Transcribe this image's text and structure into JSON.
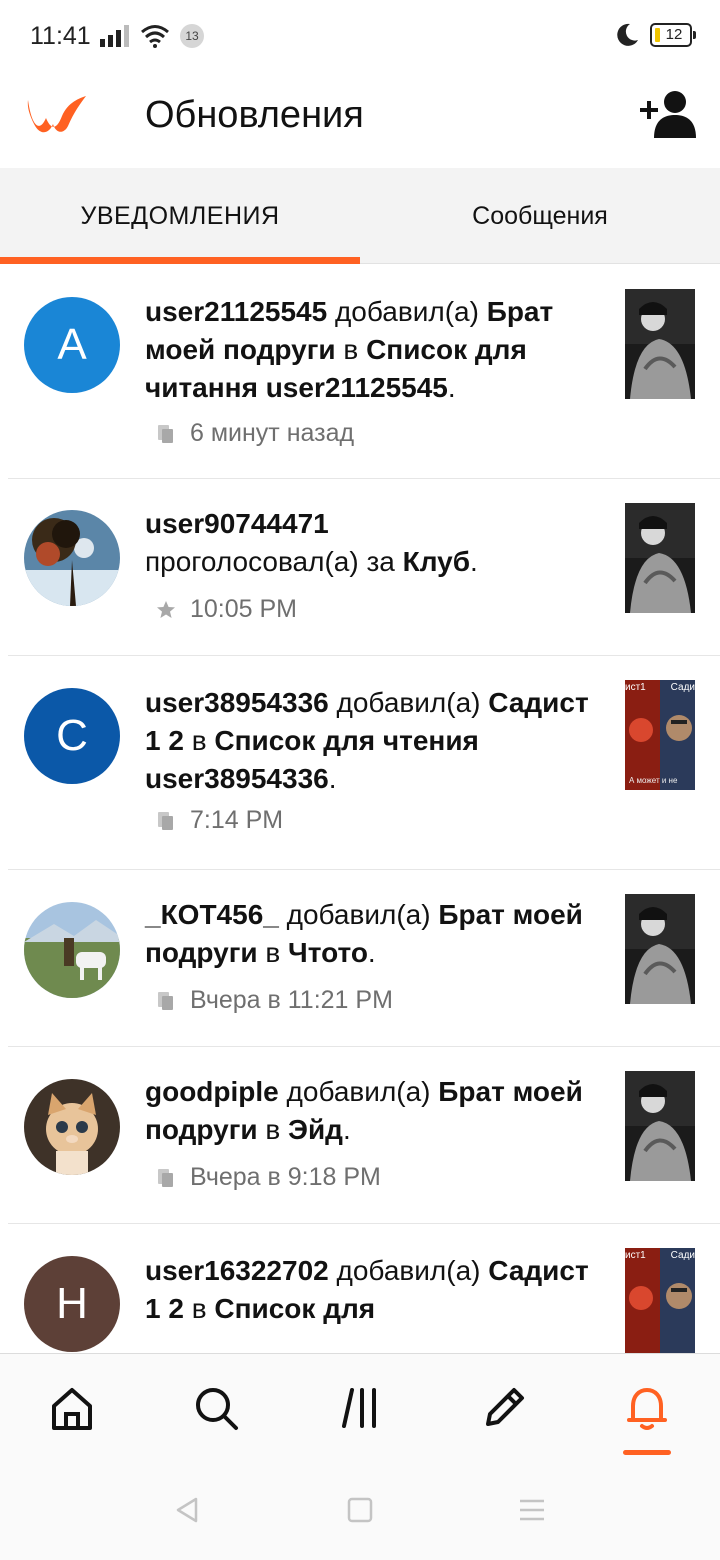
{
  "status_bar": {
    "time": "11:41",
    "notification_count": "13",
    "battery_level": "12"
  },
  "header": {
    "title": "Обновления",
    "logo_icon": "wattpad-logo-icon",
    "add_user_icon": "add-user-icon"
  },
  "tabs": [
    {
      "label": "УВЕДОМЛЕНИЯ",
      "active": true
    },
    {
      "label": "Сообщения",
      "active": false
    }
  ],
  "notifications": [
    {
      "avatar_letter": "A",
      "avatar_color": "#1a86d6",
      "user": "user21125545",
      "action": "добавил(а)",
      "story": "Брат моей подруги",
      "in_word": "в",
      "list": "Список для читання user21125545",
      "suffix": ".",
      "time": "6 минут назад",
      "meta_icon": "reading-list-icon"
    },
    {
      "avatar_letter": "",
      "avatar_color": "#3a5f7a",
      "user": "user90744471",
      "action": "проголосовал(а) за",
      "story": "Клуб",
      "suffix": ".",
      "time": "10:05 PM",
      "meta_icon": "star-icon"
    },
    {
      "avatar_letter": "C",
      "avatar_color": "#0b58a8",
      "user": "user38954336",
      "action": "добавил(а)",
      "story": "Садист 1 2",
      "in_word": "в",
      "list": "Список для чтения user38954336",
      "suffix": ".",
      "time": "7:14 PM",
      "meta_icon": "reading-list-icon",
      "thumb_text_left": "ист1",
      "thumb_text_right": "Сади",
      "thumb_caption": "А может и не"
    },
    {
      "avatar_letter": "",
      "avatar_color": "#6f8a4f",
      "user": "_КОТ456_",
      "action": "добавил(а)",
      "story": "Брат моей подруги",
      "in_word": "в",
      "list": "Чтото",
      "suffix": ".",
      "time": "Вчера в 11:21 PM",
      "meta_icon": "reading-list-icon"
    },
    {
      "avatar_letter": "",
      "avatar_color": "#5a4a3c",
      "user": "goodpiple",
      "action": "добавил(а)",
      "story": "Брат моей подруги",
      "in_word": "в",
      "list": "Эйд",
      "suffix": ".",
      "time": "Вчера в 9:18 PM",
      "meta_icon": "reading-list-icon"
    },
    {
      "avatar_letter": "H",
      "avatar_color": "#5d4037",
      "user": "user16322702",
      "action": "добавил(а)",
      "story": "Садист 1 2",
      "in_word": "в",
      "list": "Список для",
      "time": "",
      "thumb_text_left": "ист1",
      "thumb_text_right": "Сади"
    }
  ],
  "bottom_nav": [
    {
      "icon": "home-icon",
      "active": false
    },
    {
      "icon": "search-icon",
      "active": false
    },
    {
      "icon": "library-icon",
      "active": false
    },
    {
      "icon": "pencil-icon",
      "active": false
    },
    {
      "icon": "bell-icon",
      "active": true
    }
  ],
  "colors": {
    "accent": "#ff6122",
    "text": "#121212",
    "muted": "#6f6f6f"
  }
}
